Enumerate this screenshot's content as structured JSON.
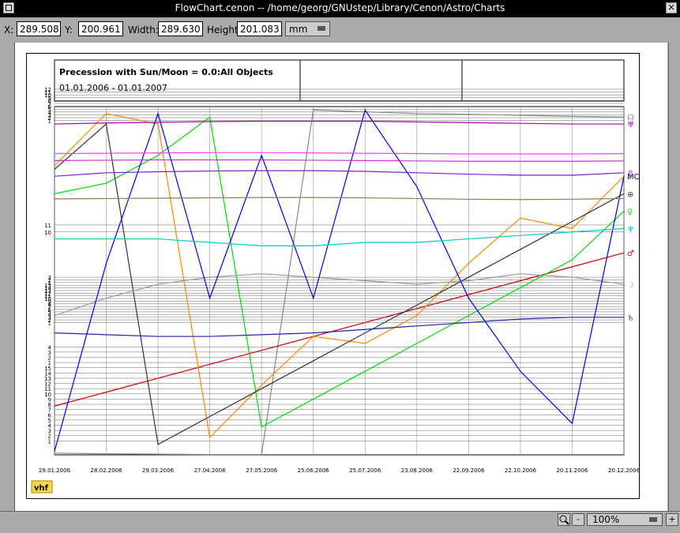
{
  "window": {
    "title": "FlowChart.cenon  --  /home/georg/GNUstep/Library/Cenon/Astro/Charts"
  },
  "toolbar": {
    "x_label": "X:",
    "x_value": "289.508",
    "y_label": "Y:",
    "y_value": "200.961",
    "width_label": "Width:",
    "width_value": "289.630",
    "height_label": "Height:",
    "height_value": "201.083",
    "unit": "mm"
  },
  "header": {
    "title": "Precession with Sun/Moon = 0.0:All Objects",
    "date_range": "01.01.2006 - 01.01.2007"
  },
  "statusbar": {
    "zoom_in_icon": "magnifier-icon",
    "zoom_out": "-",
    "zoom": "100%",
    "plus": "+"
  },
  "logo": "vhf",
  "chart_data": {
    "type": "line",
    "x": [
      "29.01.2006",
      "28.02.2006",
      "29.03.2006",
      "27.04.2006",
      "27.05.2006",
      "25.06.2006",
      "25.07.2006",
      "23.08.2006",
      "22.09.2006",
      "22.10.2006",
      "20.11.2006",
      "20.12.2006"
    ],
    "ylim": [
      0,
      100
    ],
    "grid": true,
    "y_tick_labels": [
      "1",
      "2",
      "3",
      "4",
      "5",
      "6",
      "7",
      "8",
      "9",
      "10",
      "11",
      "12",
      "13",
      "14",
      "15"
    ],
    "horizontal_scale_rows": [
      [
        "12",
        "11",
        "10",
        "9",
        "8",
        "7",
        "6",
        "5",
        "4",
        "3",
        "2",
        "1"
      ],
      [
        "11",
        "10"
      ],
      [
        "3",
        "2",
        "1",
        "15",
        "14",
        "13",
        "12",
        "11",
        "10",
        "9",
        "8",
        "7",
        "6",
        "5",
        "4",
        "3",
        "2",
        "1"
      ],
      [
        "4",
        "3",
        "2",
        "1",
        "15",
        "14",
        "13",
        "12",
        "11",
        "10",
        "9",
        "8",
        "7",
        "6",
        "5",
        "4",
        "3",
        "2",
        "1"
      ]
    ],
    "series": [
      {
        "name": "☊",
        "color": "#888888",
        "values": [
          0.5,
          0.3,
          0.2,
          0.1,
          0.1,
          99,
          98.5,
          98,
          97.8,
          97.5,
          97.2,
          97
        ]
      },
      {
        "name": "♂",
        "color": "#cc0000",
        "values": [
          14,
          18,
          22,
          26,
          30,
          34,
          38,
          42,
          46,
          50,
          54,
          58
        ]
      },
      {
        "name": "☿",
        "color": "#ff8800",
        "values": [
          83,
          98,
          95,
          5,
          20,
          34,
          32,
          40,
          55,
          68,
          65,
          80
        ]
      },
      {
        "name": "♀",
        "color": "#00dd00",
        "values": [
          75,
          78,
          86,
          97,
          8,
          16,
          24,
          32,
          40,
          48,
          56,
          70
        ]
      },
      {
        "name": "⊕",
        "color": "#333333",
        "values": [
          82,
          95,
          3,
          11,
          19,
          27,
          35,
          43,
          51,
          59,
          67,
          75
        ]
      },
      {
        "name": "☽",
        "color": "#999999",
        "values": [
          40,
          45,
          49,
          51,
          52,
          51,
          50,
          49,
          50,
          52,
          51,
          49
        ]
      },
      {
        "name": "♄",
        "color": "#2222aa",
        "values": [
          35,
          34.5,
          34,
          34,
          34.5,
          35,
          36,
          37,
          38,
          39,
          39.5,
          39.5
        ]
      },
      {
        "name": "MC",
        "color": "#0000ee",
        "values": [
          1,
          55,
          98,
          45,
          86,
          45,
          99,
          77,
          45,
          24,
          9,
          80
        ]
      },
      {
        "name": "♆",
        "color": "#00cccc",
        "values": [
          62,
          62,
          62,
          61,
          60,
          60,
          61,
          61,
          62,
          63,
          64,
          65
        ]
      },
      {
        "name": "♅",
        "color": "#aa00aa",
        "values": [
          95,
          95.3,
          95.5,
          95.7,
          95.8,
          95.8,
          95.8,
          95.6,
          95.4,
          95.2,
          95,
          95
        ]
      },
      {
        "name": "♇",
        "color": "#7722cc",
        "values": [
          80,
          81,
          81.3,
          81.5,
          81.6,
          81.6,
          81.4,
          81,
          80.6,
          80.3,
          80.3,
          81
        ]
      },
      {
        "name": "",
        "color": "#cc33cc",
        "values": [
          84.5,
          84.6,
          84.7,
          84.7,
          84.7,
          84.6,
          84.5,
          84.4,
          84.3,
          84.3,
          84.3,
          84.4
        ]
      },
      {
        "name": "",
        "color": "#ff44ff",
        "values": [
          86.5,
          86.6,
          86.7,
          86.8,
          86.8,
          86.7,
          86.6,
          86.5,
          86.4,
          86.4,
          86.4,
          86.5
        ]
      },
      {
        "name": "",
        "color": "#997755",
        "values": [
          73.5,
          73.6,
          73.7,
          73.8,
          73.9,
          73.9,
          73.8,
          73.6,
          73.4,
          73.3,
          73.4,
          73.6
        ]
      }
    ],
    "legend_symbols": [
      "☊",
      "♅",
      "MC",
      "♇",
      "♀",
      "⊕",
      "☿",
      "♂",
      "♆",
      "☽",
      "♄"
    ]
  }
}
